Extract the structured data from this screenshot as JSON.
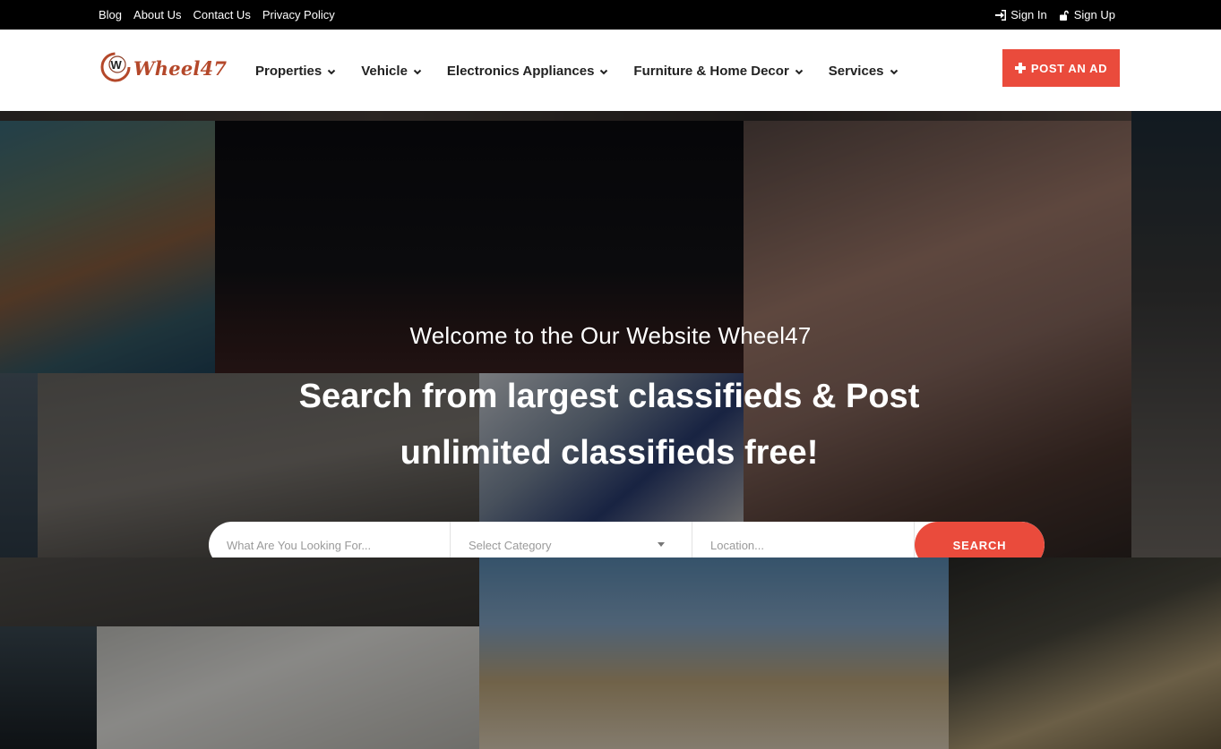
{
  "topbar": {
    "links": [
      "Blog",
      "About Us",
      "Contact Us",
      "Privacy Policy"
    ],
    "sign_in": "Sign In",
    "sign_up": "Sign Up"
  },
  "header": {
    "logo_text": "Wheel47",
    "nav": [
      "Properties",
      "Vehicle",
      "Electronics Appliances",
      "Furniture & Home Decor",
      "Services"
    ],
    "post_ad_label": "POST AN AD"
  },
  "hero": {
    "welcome": "Welcome to the Our Website Wheel47",
    "headline_line1": "Search from largest classifieds & Post",
    "headline_line2": "unlimited classifieds free!"
  },
  "search": {
    "what_placeholder": "What Are You Looking For...",
    "category_value": "Select Category",
    "location_placeholder": "Location...",
    "button_label": "SEARCH"
  },
  "colors": {
    "accent": "#ea4b3c",
    "logo": "#b4482a",
    "topbar_bg": "#000000"
  }
}
